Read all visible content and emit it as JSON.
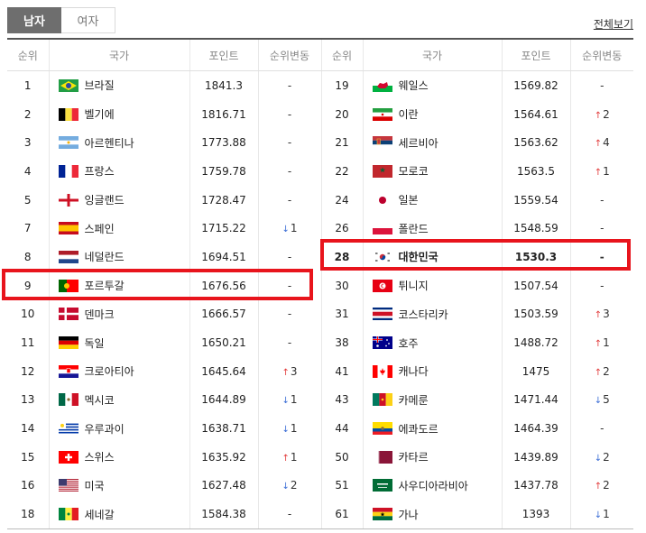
{
  "tabs": {
    "men": "남자",
    "women": "여자"
  },
  "view_all": "전체보기",
  "headers": [
    "순위",
    "국가",
    "포인트",
    "순위변동",
    "순위",
    "국가",
    "포인트",
    "순위변동"
  ],
  "colors": {
    "up": "#e23b3b",
    "down": "#3d6fd6",
    "highlight": "#e8141c"
  },
  "left": [
    {
      "rank": "1",
      "country": "브라질",
      "flag": "brazil-flag-icon",
      "points": "1841.3",
      "change": "-"
    },
    {
      "rank": "2",
      "country": "벨기에",
      "flag": "belgium-flag-icon",
      "points": "1816.71",
      "change": "-"
    },
    {
      "rank": "3",
      "country": "아르헨티나",
      "flag": "argentina-flag-icon",
      "points": "1773.88",
      "change": "-"
    },
    {
      "rank": "4",
      "country": "프랑스",
      "flag": "france-flag-icon",
      "points": "1759.78",
      "change": "-"
    },
    {
      "rank": "5",
      "country": "잉글랜드",
      "flag": "england-flag-icon",
      "points": "1728.47",
      "change": "-"
    },
    {
      "rank": "7",
      "country": "스페인",
      "flag": "spain-flag-icon",
      "points": "1715.22",
      "change": "↓",
      "change_num": "1",
      "dir": "down"
    },
    {
      "rank": "8",
      "country": "네덜란드",
      "flag": "netherlands-flag-icon",
      "points": "1694.51",
      "change": "-"
    },
    {
      "rank": "9",
      "country": "포르투갈",
      "flag": "portugal-flag-icon",
      "points": "1676.56",
      "change": "-"
    },
    {
      "rank": "10",
      "country": "덴마크",
      "flag": "denmark-flag-icon",
      "points": "1666.57",
      "change": "-"
    },
    {
      "rank": "11",
      "country": "독일",
      "flag": "germany-flag-icon",
      "points": "1650.21",
      "change": "-"
    },
    {
      "rank": "12",
      "country": "크로아티아",
      "flag": "croatia-flag-icon",
      "points": "1645.64",
      "change": "↑",
      "change_num": "3",
      "dir": "up"
    },
    {
      "rank": "13",
      "country": "멕시코",
      "flag": "mexico-flag-icon",
      "points": "1644.89",
      "change": "↓",
      "change_num": "1",
      "dir": "down"
    },
    {
      "rank": "14",
      "country": "우루과이",
      "flag": "uruguay-flag-icon",
      "points": "1638.71",
      "change": "↓",
      "change_num": "1",
      "dir": "down"
    },
    {
      "rank": "15",
      "country": "스위스",
      "flag": "switzerland-flag-icon",
      "points": "1635.92",
      "change": "↑",
      "change_num": "1",
      "dir": "up"
    },
    {
      "rank": "16",
      "country": "미국",
      "flag": "usa-flag-icon",
      "points": "1627.48",
      "change": "↓",
      "change_num": "2",
      "dir": "down"
    },
    {
      "rank": "18",
      "country": "세네갈",
      "flag": "senegal-flag-icon",
      "points": "1584.38",
      "change": "-"
    }
  ],
  "right": [
    {
      "rank": "19",
      "country": "웨일스",
      "flag": "wales-flag-icon",
      "points": "1569.82",
      "change": "-"
    },
    {
      "rank": "20",
      "country": "이란",
      "flag": "iran-flag-icon",
      "points": "1564.61",
      "change": "↑",
      "change_num": "2",
      "dir": "up"
    },
    {
      "rank": "21",
      "country": "세르비아",
      "flag": "serbia-flag-icon",
      "points": "1563.62",
      "change": "↑",
      "change_num": "4",
      "dir": "up"
    },
    {
      "rank": "22",
      "country": "모로코",
      "flag": "morocco-flag-icon",
      "points": "1563.5",
      "change": "↑",
      "change_num": "1",
      "dir": "up"
    },
    {
      "rank": "24",
      "country": "일본",
      "flag": "japan-flag-icon",
      "points": "1559.54",
      "change": "-"
    },
    {
      "rank": "26",
      "country": "폴란드",
      "flag": "poland-flag-icon",
      "points": "1548.59",
      "change": "-"
    },
    {
      "rank": "28",
      "country": "대한민국",
      "flag": "korea-flag-icon",
      "points": "1530.3",
      "change": "-"
    },
    {
      "rank": "30",
      "country": "튀니지",
      "flag": "tunisia-flag-icon",
      "points": "1507.54",
      "change": "-"
    },
    {
      "rank": "31",
      "country": "코스타리카",
      "flag": "costa-rica-flag-icon",
      "points": "1503.59",
      "change": "↑",
      "change_num": "3",
      "dir": "up"
    },
    {
      "rank": "38",
      "country": "호주",
      "flag": "australia-flag-icon",
      "points": "1488.72",
      "change": "↑",
      "change_num": "1",
      "dir": "up"
    },
    {
      "rank": "41",
      "country": "캐나다",
      "flag": "canada-flag-icon",
      "points": "1475",
      "change": "↑",
      "change_num": "2",
      "dir": "up"
    },
    {
      "rank": "43",
      "country": "카메룬",
      "flag": "cameroon-flag-icon",
      "points": "1471.44",
      "change": "↓",
      "change_num": "5",
      "dir": "down"
    },
    {
      "rank": "44",
      "country": "에콰도르",
      "flag": "ecuador-flag-icon",
      "points": "1464.39",
      "change": "-"
    },
    {
      "rank": "50",
      "country": "카타르",
      "flag": "qatar-flag-icon",
      "points": "1439.89",
      "change": "↓",
      "change_num": "2",
      "dir": "down"
    },
    {
      "rank": "51",
      "country": "사우디아라비아",
      "flag": "saudi-arabia-flag-icon",
      "points": "1437.78",
      "change": "↑",
      "change_num": "2",
      "dir": "up"
    },
    {
      "rank": "61",
      "country": "가나",
      "flag": "ghana-flag-icon",
      "points": "1393",
      "change": "↓",
      "change_num": "1",
      "dir": "down"
    }
  ]
}
